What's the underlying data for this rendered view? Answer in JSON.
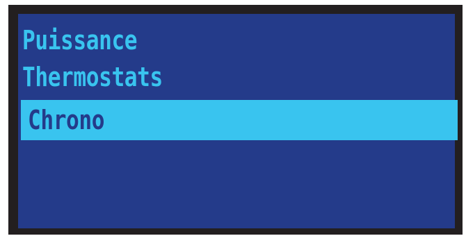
{
  "menu": {
    "items": [
      {
        "label": "Puissance",
        "selected": false
      },
      {
        "label": "Thermostats",
        "selected": false
      },
      {
        "label": "Chrono",
        "selected": true
      }
    ]
  },
  "colors": {
    "bezel": "#231f20",
    "screen_background": "#243b8a",
    "text": "#39c4ef",
    "highlight": "#39c4ef",
    "highlight_text": "#243b8a"
  }
}
